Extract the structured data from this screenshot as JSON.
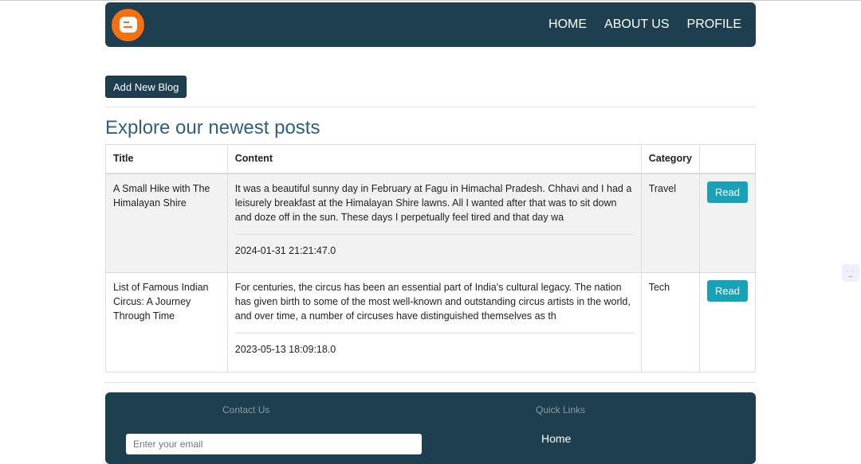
{
  "nav": {
    "links": [
      "HOME",
      "ABOUT US",
      "PROFILE"
    ]
  },
  "add_button": "Add New Blog",
  "heading": "Explore our newest posts",
  "table": {
    "headers": [
      "Title",
      "Content",
      "Category",
      ""
    ],
    "rows": [
      {
        "title": "A Small Hike with The Himalayan Shire",
        "content": "It was a beautiful sunny day in February at Fagu in Himachal Pradesh. Chhavi and I had a leisurely breakfast at the Himalayan Shire lawns. All I wanted after that was to sit down and doze off in the sun. These days I perpetually feel tired and that day wa",
        "date": "2024-01-31 21:21:47.0",
        "category": "Travel",
        "action": "Read"
      },
      {
        "title": "List of Famous Indian Circus: A Journey Through Time",
        "content": "For centuries, the circus has been an essential part of India's cultural legacy. The nation has given birth to some of the most well-known and outstanding circus artists in the world, and over time, a number of circuses have distinguished themselves as th",
        "date": "2023-05-13 18:09:18.0",
        "category": "Tech",
        "action": "Read"
      }
    ]
  },
  "footer": {
    "contact_heading": "Contact Us",
    "email_placeholder": "Enter your email",
    "links_heading": "Quick Links",
    "links": [
      "Home"
    ]
  }
}
